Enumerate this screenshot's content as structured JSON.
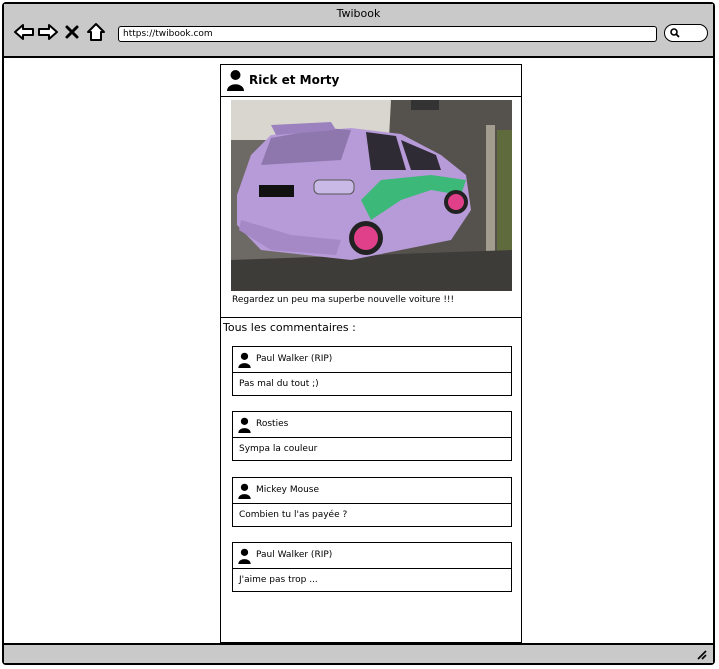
{
  "browser": {
    "title": "Twibook",
    "url": "https://twibook.com"
  },
  "post": {
    "author": "Rick et Morty",
    "caption": "Regardez un peu ma superbe nouvelle voiture !!!",
    "comments_title": "Tous les commentaires :",
    "comments": [
      {
        "author": "Paul Walker (RIP)",
        "text": "Pas mal du tout ;)"
      },
      {
        "author": "Rosties",
        "text": "Sympa la couleur"
      },
      {
        "author": "Mickey Mouse",
        "text": "Combien tu l'as payée ?"
      },
      {
        "author": "Paul Walker (RIP)",
        "text": "J'aime pas trop ..."
      }
    ]
  },
  "colors": {
    "chrome": "#c9c9c9",
    "car": "#b79ad8",
    "rims": "#e0408a",
    "stripe": "#3cb878"
  }
}
